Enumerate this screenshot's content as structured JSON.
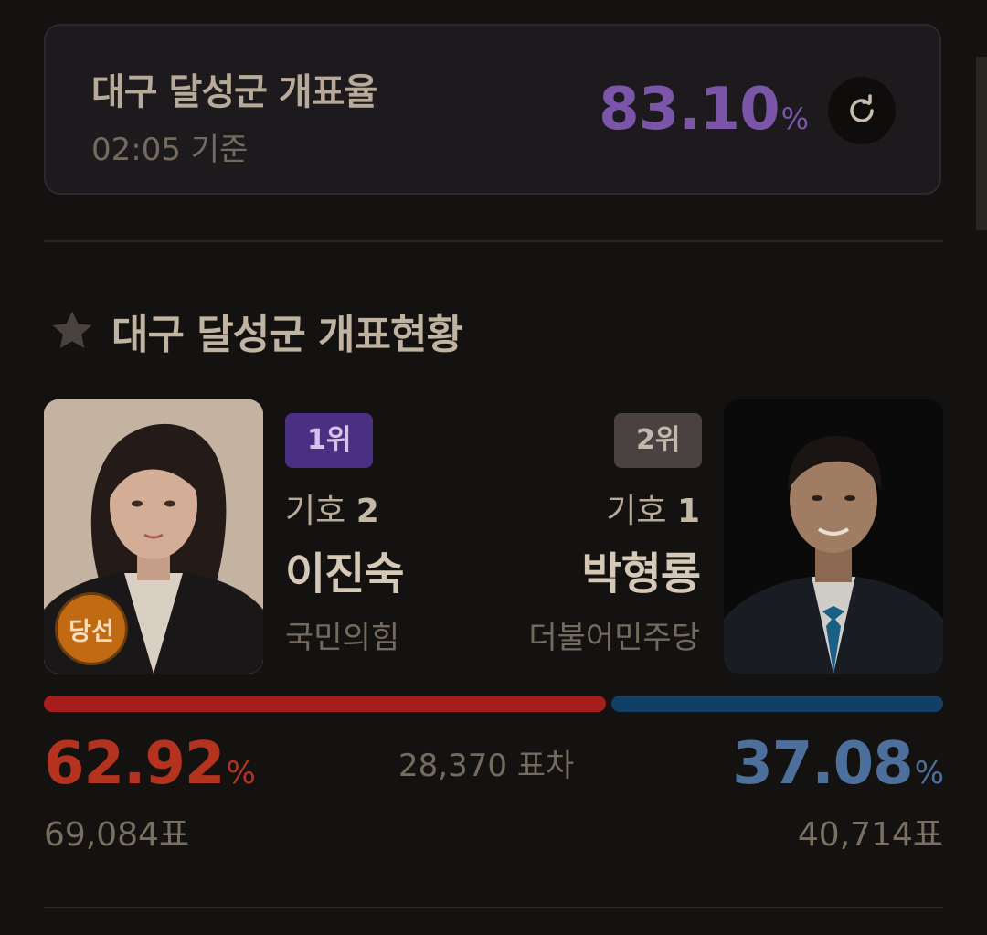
{
  "summary": {
    "title": "대구 달성군 개표율",
    "time": "02:05 기준",
    "rate": "83.10",
    "rate_unit": "%",
    "refresh_icon": "refresh-icon"
  },
  "section": {
    "title": "대구 달성군 개표현황",
    "icon": "star-icon"
  },
  "candidates": [
    {
      "rank": "1위",
      "ballot_label": "기호",
      "ballot_number": "2",
      "name": "이진숙",
      "party": "국민의힘",
      "badge": "당선",
      "percent": "62.92",
      "percent_unit": "%",
      "votes": "69,084표",
      "color": "#a71d1b"
    },
    {
      "rank": "2위",
      "ballot_label": "기호",
      "ballot_number": "1",
      "name": "박형룡",
      "party": "더불어민주당",
      "percent": "37.08",
      "percent_unit": "%",
      "votes": "40,714표",
      "color": "#123f66"
    }
  ],
  "difference": "28,370 표차",
  "colors": {
    "rate": "#7a55a8",
    "rank1": "#4a2f82",
    "rank2": "#4a4240",
    "winner_badge": "#c06a14"
  }
}
